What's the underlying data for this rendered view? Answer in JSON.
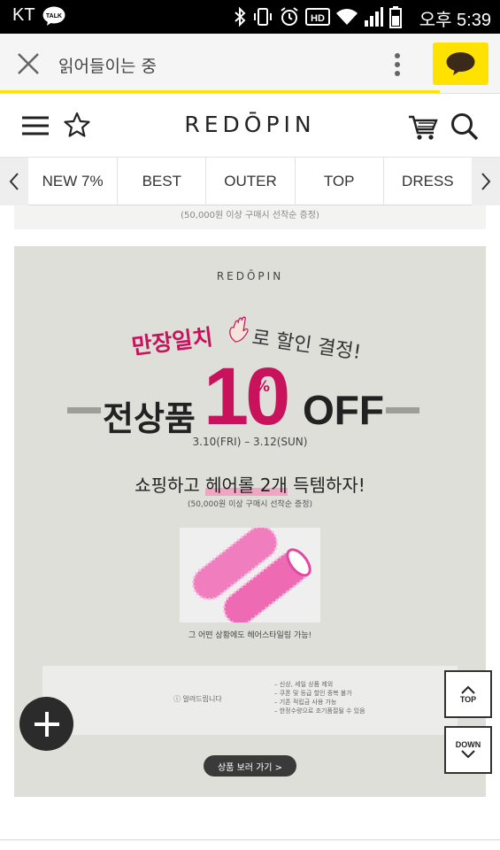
{
  "status_bar": {
    "carrier": "KT",
    "talk_badge": "TALK",
    "time": "오후 5:39",
    "icons": [
      "bluetooth-icon",
      "vibrate-icon",
      "alarm-icon",
      "hd-icon",
      "wifi-icon",
      "signal-icon",
      "battery-icon"
    ],
    "hd_label": "HD"
  },
  "browser": {
    "title": "읽어들이는 중",
    "load_progress": 0.88,
    "accent": "#ffe200"
  },
  "site_header": {
    "logo": "REDŌPIN"
  },
  "category_nav": {
    "tabs": [
      "NEW 7%",
      "BEST",
      "OUTER",
      "TOP",
      "DRESS"
    ]
  },
  "content": {
    "prev_banner_text": "(50,000원 이상 구매시 선착순 증정)",
    "promo": {
      "logo": "REDŌPIN",
      "tagline_part1": "만장일치",
      "tagline_part2": "로 할인 결정!",
      "label": "전상품",
      "discount": "10",
      "percent": "%",
      "off": "OFF",
      "dates": "3.10(FRI) – 3.12(SUN)",
      "headline_pre": "쇼핑하고 ",
      "headline_highlight": "헤어롤 2개",
      "headline_post": " 득템하자!",
      "sub": "(50,000원 이상 구매시 선착순 증정)",
      "caption": "그 어떤 상황에도 헤어스타일링 가능!",
      "accent": "#c8125b"
    },
    "notice": {
      "label": "알려드립니다",
      "items": [
        "– 신상, 세일 상품 제외",
        "– 쿠폰 및 등급 할인 중복 불가",
        "– 기존 적립금 사용 가능",
        "– 한정수량으로 조기품절될 수 있음"
      ]
    },
    "shop_button": "상품 보러 가기 >"
  },
  "floating": {
    "top_label": "TOP",
    "down_label": "DOWN"
  }
}
